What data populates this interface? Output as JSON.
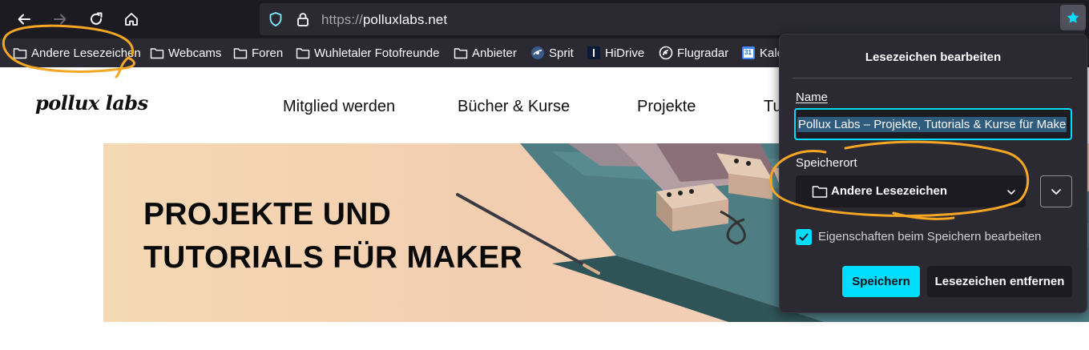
{
  "browser": {
    "url_protocol": "https://",
    "url_host": "polluxlabs.net"
  },
  "bookmarks": [
    {
      "label": "Andere Lesezeichen",
      "icon": "folder-icon"
    },
    {
      "label": "Webcams",
      "icon": "folder-icon"
    },
    {
      "label": "Foren",
      "icon": "folder-icon"
    },
    {
      "label": "Wuhletaler Fotofreunde",
      "icon": "folder-icon"
    },
    {
      "label": "Anbieter",
      "icon": "folder-icon"
    },
    {
      "label": "Sprit",
      "icon": "sprit-favicon"
    },
    {
      "label": "HiDrive",
      "icon": "hidrive-favicon"
    },
    {
      "label": "Flugradar",
      "icon": "flugradar-favicon"
    },
    {
      "label": "Kale",
      "icon": "calendar-favicon",
      "badge": "31"
    }
  ],
  "website": {
    "logo": "pollux labs",
    "menu": [
      "Mitglied werden",
      "Bücher & Kurse",
      "Projekte",
      "Tu"
    ],
    "hero_line1": "PROJEKTE UND",
    "hero_line2": "TUTORIALS FÜR MAKER"
  },
  "bookmark_panel": {
    "title": "Lesezeichen bearbeiten",
    "name_label": "Name",
    "name_value": "Pollux Labs – Projekte, Tutorials & Kurse für Make",
    "location_label": "Speicherort",
    "location_value": "Andere Lesezeichen",
    "checkbox_label": "Eigenschaften beim Speichern bearbeiten",
    "checkbox_checked": true,
    "save_label": "Speichern",
    "remove_label": "Lesezeichen entfernen"
  },
  "colors": {
    "accent": "#00ddff",
    "annotation": "#f5a623",
    "toolbar_bg": "#1c1b22",
    "panel_bg": "#2b2a33"
  }
}
